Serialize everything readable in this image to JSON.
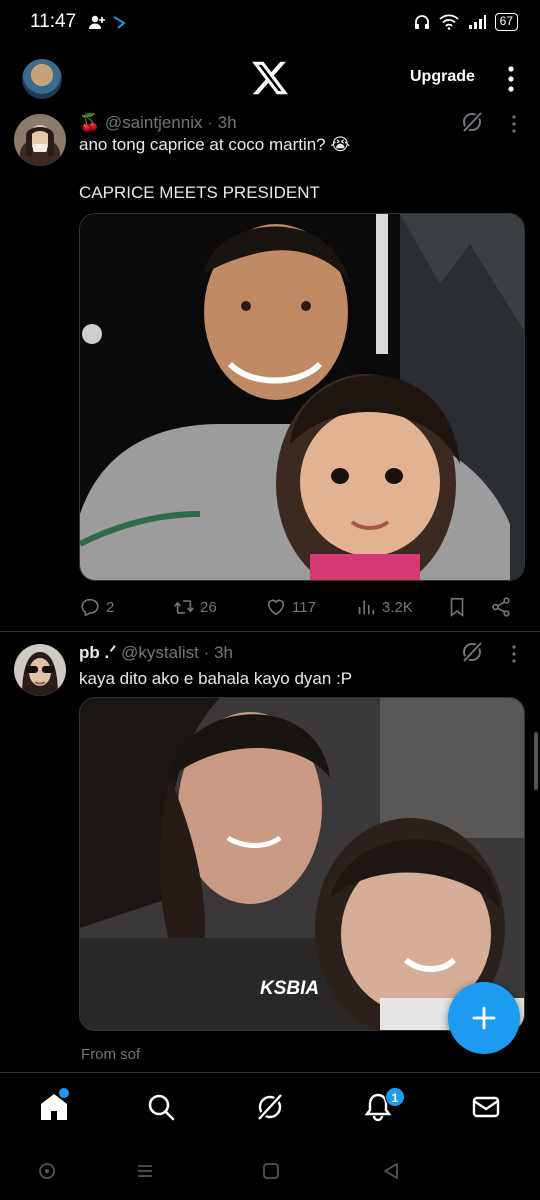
{
  "status_bar": {
    "time": "11:47",
    "battery": "67"
  },
  "header": {
    "upgrade_label": "Upgrade"
  },
  "tweets": [
    {
      "emoji": "🍒",
      "handle": "@saintjennix",
      "time": "· 3h",
      "text": "ano tong caprice at coco martin? 😭",
      "text2": "CAPRICE MEETS PRESIDENT",
      "replies": "2",
      "retweets": "26",
      "likes": "117",
      "views": "3.2K"
    },
    {
      "name": "pb .ᐟ",
      "handle": "@kystalist",
      "time": "· 3h",
      "text": "kaya dito ako e bahala kayo dyan :P",
      "media_caption": "KSBIA"
    }
  ],
  "community_note": "From sof",
  "nav": {
    "notifications_badge": "1"
  },
  "colors": {
    "accent": "#1d9bf0",
    "background": "#000000",
    "secondary_text": "#71767b"
  }
}
